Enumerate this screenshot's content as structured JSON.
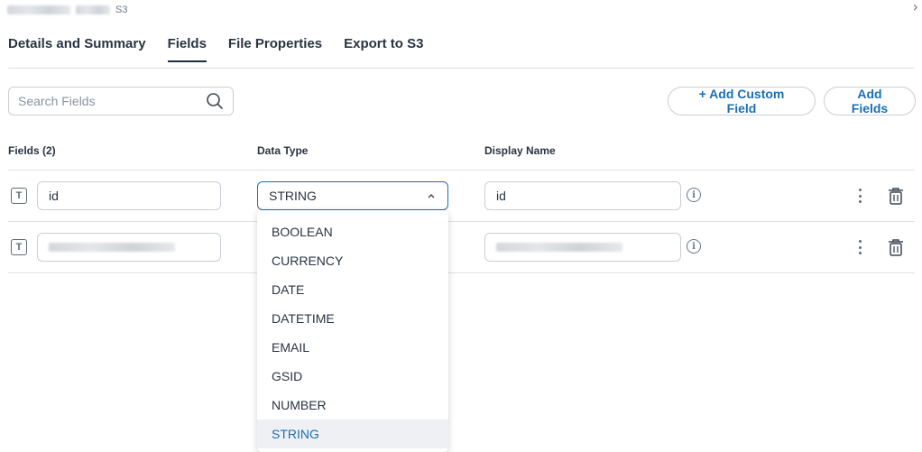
{
  "header": {
    "crumb_suffix": "S3",
    "close_glyph": "›"
  },
  "tabs": [
    {
      "label": "Details and Summary"
    },
    {
      "label": "Fields"
    },
    {
      "label": "File Properties"
    },
    {
      "label": "Export to S3"
    }
  ],
  "active_tab": "Fields",
  "search": {
    "placeholder": "Search Fields"
  },
  "toolbar": {
    "add_custom_label": "+ Add Custom Field",
    "add_fields_label": "Add Fields"
  },
  "table": {
    "columns": {
      "fields": "Fields (2)",
      "data_type": "Data Type",
      "display_name": "Display Name"
    },
    "rows": [
      {
        "type_icon": "T",
        "field": "id",
        "data_type": "STRING",
        "display_name": "id"
      },
      {
        "type_icon": "T",
        "field": "",
        "data_type": "",
        "display_name": ""
      }
    ]
  },
  "dropdown": {
    "options": [
      "BOOLEAN",
      "CURRENCY",
      "DATE",
      "DATETIME",
      "EMAIL",
      "GSID",
      "NUMBER",
      "STRING"
    ],
    "selected": "STRING"
  },
  "colors": {
    "accent": "#1a6fb5",
    "text": "#2a3441",
    "border": "#c9ced5",
    "selected_bg": "#eef0f3"
  },
  "icons": {
    "search": "search-icon",
    "info": "info-icon",
    "kebab": "kebab-icon",
    "trash": "trash-icon",
    "text_type": "text-type-icon",
    "chevron": "chevron-up-icon"
  }
}
